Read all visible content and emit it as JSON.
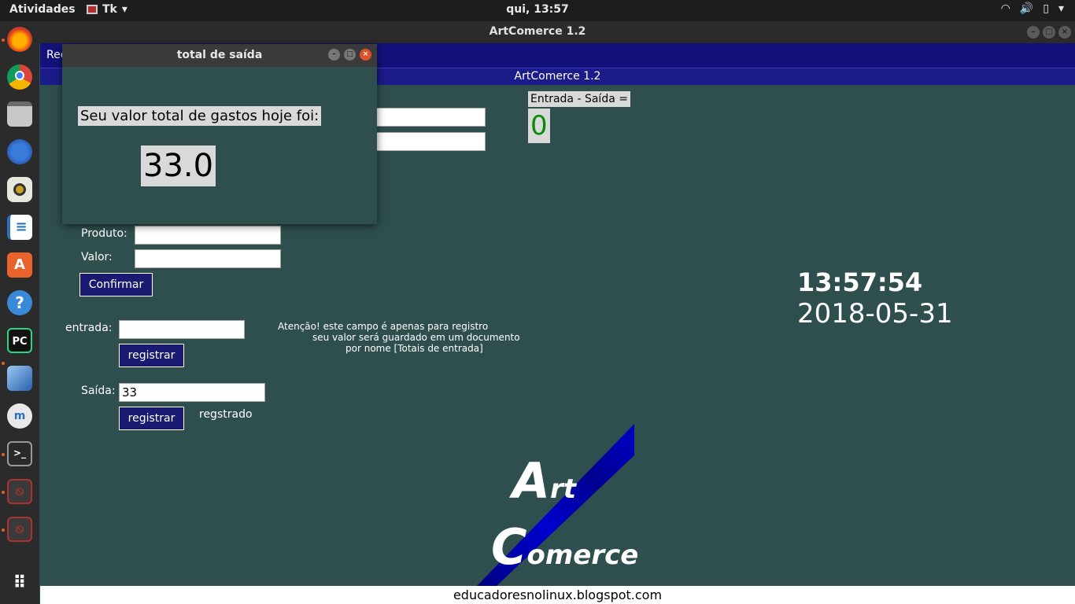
{
  "topbar": {
    "activities": "Atividades",
    "app_menu": "Tk",
    "clock": "qui, 13:57"
  },
  "window": {
    "title": "ArtComerce 1.2"
  },
  "menubar": {
    "label": "Rec"
  },
  "app": {
    "title": "ArtComerce 1.2",
    "entrada_saida_label": "Entrada - Saída =",
    "entrada_saida_value": "0",
    "produto_label": "Produto:",
    "produto_value": "",
    "valor_label": "Valor:",
    "valor_value": "",
    "confirmar_button": "Confirmar",
    "entrada_label": "entrada:",
    "entrada_value": "",
    "registrar_entrada_button": "registrar",
    "note_line1": "Atenção! este campo é apenas para registro",
    "note_line2": "seu valor será guardado em um documento",
    "note_line3": "por nome [Totais de entrada]",
    "saida_label": "Saída:",
    "saida_value": "33",
    "registrar_saida_button": "registrar",
    "registrado_status": "regstrado",
    "clock_time": "13:57:54",
    "clock_date": "2018-05-31",
    "logo_word1": "Art",
    "logo_word2": "Comerce"
  },
  "popup": {
    "title": "total de saída",
    "message": "Seu valor total de gastos hoje foi:",
    "total": "33.0"
  },
  "footer": {
    "text": "educadoresnolinux.blogspot.com"
  },
  "dock": {
    "items": [
      "firefox-icon",
      "chrome-icon",
      "files-icon",
      "thunderbird-icon",
      "rhythmbox-icon",
      "writer-icon",
      "software-icon",
      "help-icon",
      "pycharm-icon",
      "virtualbox-icon",
      "musescore-icon",
      "terminal-icon",
      "tk-window-icon",
      "tk-window-icon",
      "show-apps-icon"
    ]
  }
}
